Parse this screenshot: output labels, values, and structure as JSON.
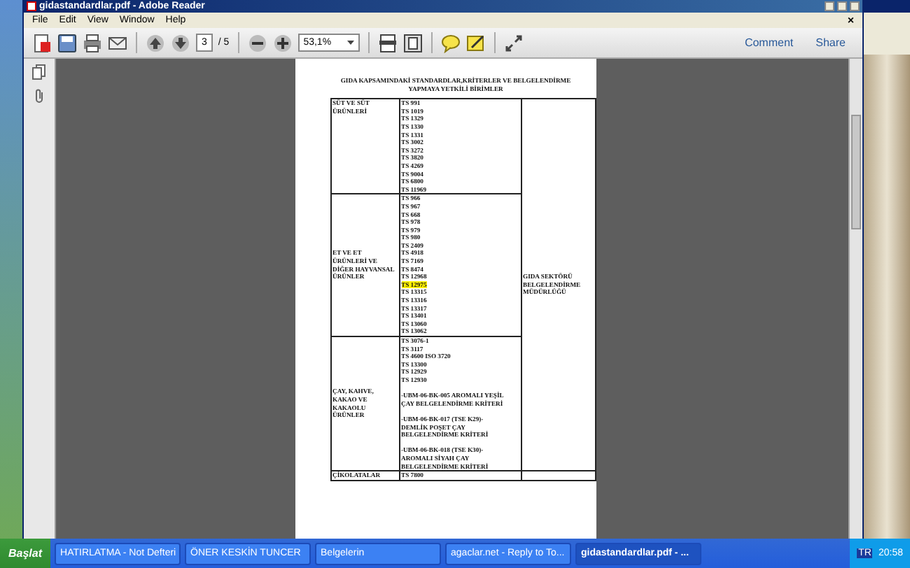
{
  "window": {
    "title": "gidastandardlar.pdf - Adobe Reader"
  },
  "menu": [
    "File",
    "Edit",
    "View",
    "Window",
    "Help"
  ],
  "close_glyph": "×",
  "toolbar": {
    "page": "3",
    "page_total": "/ 5",
    "zoom": "53,1%",
    "links": [
      "Comment",
      "Share"
    ]
  },
  "document": {
    "title": "GIDA KAPSAMINDAKİ STANDARDLAR,KRİTERLER VE BELGELENDİRME YAPMAYA YETKİLİ BİRİMLER",
    "authority": "GIDA SEKTÖRÜ BELGELENDİRME MÜDÜRLÜĞÜ",
    "rows": [
      {
        "category": "SÜT VE SÜT ÜRÜNLERİ",
        "lines": [
          {
            "kind": "standard",
            "text": "TS 991",
            "highlighted": false
          },
          {
            "kind": "standard",
            "text": "TS 1019",
            "highlighted": false
          },
          {
            "kind": "standard",
            "text": "TS 1329",
            "highlighted": false
          },
          {
            "kind": "standard",
            "text": "TS 1330",
            "highlighted": false
          },
          {
            "kind": "standard",
            "text": "TS 1331",
            "highlighted": false
          },
          {
            "kind": "standard",
            "text": "TS 3002",
            "highlighted": false
          },
          {
            "kind": "standard",
            "text": "TS 3272",
            "highlighted": false
          },
          {
            "kind": "standard",
            "text": "TS 3820",
            "highlighted": false
          },
          {
            "kind": "standard",
            "text": "TS 4269",
            "highlighted": false
          },
          {
            "kind": "standard",
            "text": "TS 9004",
            "highlighted": false
          },
          {
            "kind": "standard",
            "text": "TS 6800",
            "highlighted": false
          },
          {
            "kind": "standard",
            "text": "TS 11969",
            "highlighted": false
          }
        ]
      },
      {
        "category": "ET VE ET ÜRÜNLERİ VE DİĞER HAYVANSAL ÜRÜNLER",
        "lines": [
          {
            "kind": "standard",
            "text": "TS 966",
            "highlighted": false
          },
          {
            "kind": "standard",
            "text": "TS 967",
            "highlighted": false
          },
          {
            "kind": "standard",
            "text": "TS 668",
            "highlighted": false
          },
          {
            "kind": "standard",
            "text": "TS 978",
            "highlighted": false
          },
          {
            "kind": "standard",
            "text": "TS 979",
            "highlighted": false
          },
          {
            "kind": "standard",
            "text": "TS 980",
            "highlighted": false
          },
          {
            "kind": "standard",
            "text": "TS 2409",
            "highlighted": false
          },
          {
            "kind": "standard",
            "text": "TS 4918",
            "highlighted": false
          },
          {
            "kind": "standard",
            "text": "TS 7169",
            "highlighted": false
          },
          {
            "kind": "standard",
            "text": "TS 8474",
            "highlighted": false
          },
          {
            "kind": "standard",
            "text": "TS 12968",
            "highlighted": false
          },
          {
            "kind": "standard",
            "text": "TS 12975",
            "highlighted": true
          },
          {
            "kind": "standard",
            "text": "TS 13315",
            "highlighted": false
          },
          {
            "kind": "standard",
            "text": "TS 13316",
            "highlighted": false
          },
          {
            "kind": "standard",
            "text": "TS 13317",
            "highlighted": false
          },
          {
            "kind": "standard",
            "text": "TS 13401",
            "highlighted": false
          },
          {
            "kind": "standard",
            "text": "TS 13060",
            "highlighted": false
          },
          {
            "kind": "standard",
            "text": "TS 13062",
            "highlighted": false
          }
        ]
      },
      {
        "category": "ÇAY, KAHVE, KAKAO VE KAKAOLU ÜRÜNLER",
        "lines": [
          {
            "kind": "standard",
            "text": "TS 3076-1",
            "highlighted": false
          },
          {
            "kind": "standard",
            "text": "TS 3117",
            "highlighted": false
          },
          {
            "kind": "standard",
            "text": "TS 4600 ISO 3720",
            "highlighted": false
          },
          {
            "kind": "standard",
            "text": "TS 13300",
            "highlighted": false
          },
          {
            "kind": "standard",
            "text": "TS 12929",
            "highlighted": false
          },
          {
            "kind": "standard",
            "text": "TS 12930",
            "highlighted": false
          },
          {
            "kind": "criterion",
            "text": "-UBM-06-BK-005 AROMALI YEŞİL ÇAY BELGELENDİRME KRİTERİ",
            "highlighted": false
          },
          {
            "kind": "criterion",
            "text": "-UBM-06-BK-017 (TSE K29)- DEMLİK POŞET ÇAY BELGELENDİRME KRİTERİ",
            "highlighted": false
          },
          {
            "kind": "criterion",
            "text": "-UBM-06-BK-018 (TSE K30)- AROMALI SİYAH ÇAY BELGELENDİRME KRİTERİ",
            "highlighted": false
          }
        ]
      },
      {
        "category": "ÇİKOLATALAR",
        "lines": [
          {
            "kind": "standard",
            "text": "TS 7800",
            "highlighted": false
          }
        ]
      }
    ]
  },
  "taskbar": {
    "start": "Başlat",
    "tasks": [
      {
        "label": "HATIRLATMA - Not Defteri",
        "selected": false
      },
      {
        "label": "ÖNER KESKİN TUNCER",
        "selected": false
      },
      {
        "label": "Belgelerin",
        "selected": false
      },
      {
        "label": "agaclar.net - Reply to To...",
        "selected": false
      },
      {
        "label": "gidastandardlar.pdf - ...",
        "selected": true
      }
    ],
    "language": "TR",
    "clock": "20:58"
  }
}
